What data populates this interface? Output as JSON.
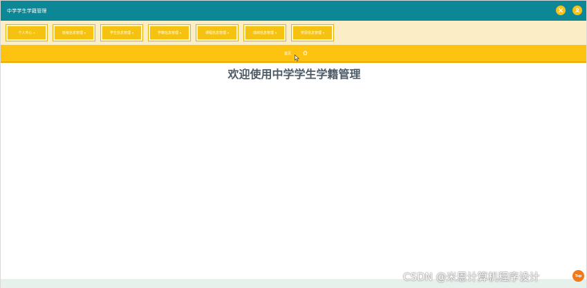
{
  "app": {
    "title": "中学学生学籍管理"
  },
  "header": {
    "close_icon": "close-icon",
    "user_icon": "user-icon"
  },
  "nav": {
    "items": [
      {
        "label": "个人中心"
      },
      {
        "label": "班级信息管理"
      },
      {
        "label": "学生信息管理"
      },
      {
        "label": "学籍信息管理"
      },
      {
        "label": "课程信息管理"
      },
      {
        "label": "成绩信息管理"
      },
      {
        "label": "奖惩信息管理"
      }
    ]
  },
  "breadcrumb": {
    "label": "首页",
    "home_icon": "home-icon"
  },
  "main": {
    "welcome": "欢迎使用中学学生学籍管理"
  },
  "watermark": {
    "text": "CSDN @米恩计算机程序设计"
  },
  "back_to_top": {
    "label": "Top"
  },
  "colors": {
    "topbar": "#0c8796",
    "navbar": "#fbeec6",
    "nav_item": "#f5c211",
    "crumbbar": "#fec311",
    "accent_button": "#f5c11a",
    "top_button": "#f07a1e"
  }
}
